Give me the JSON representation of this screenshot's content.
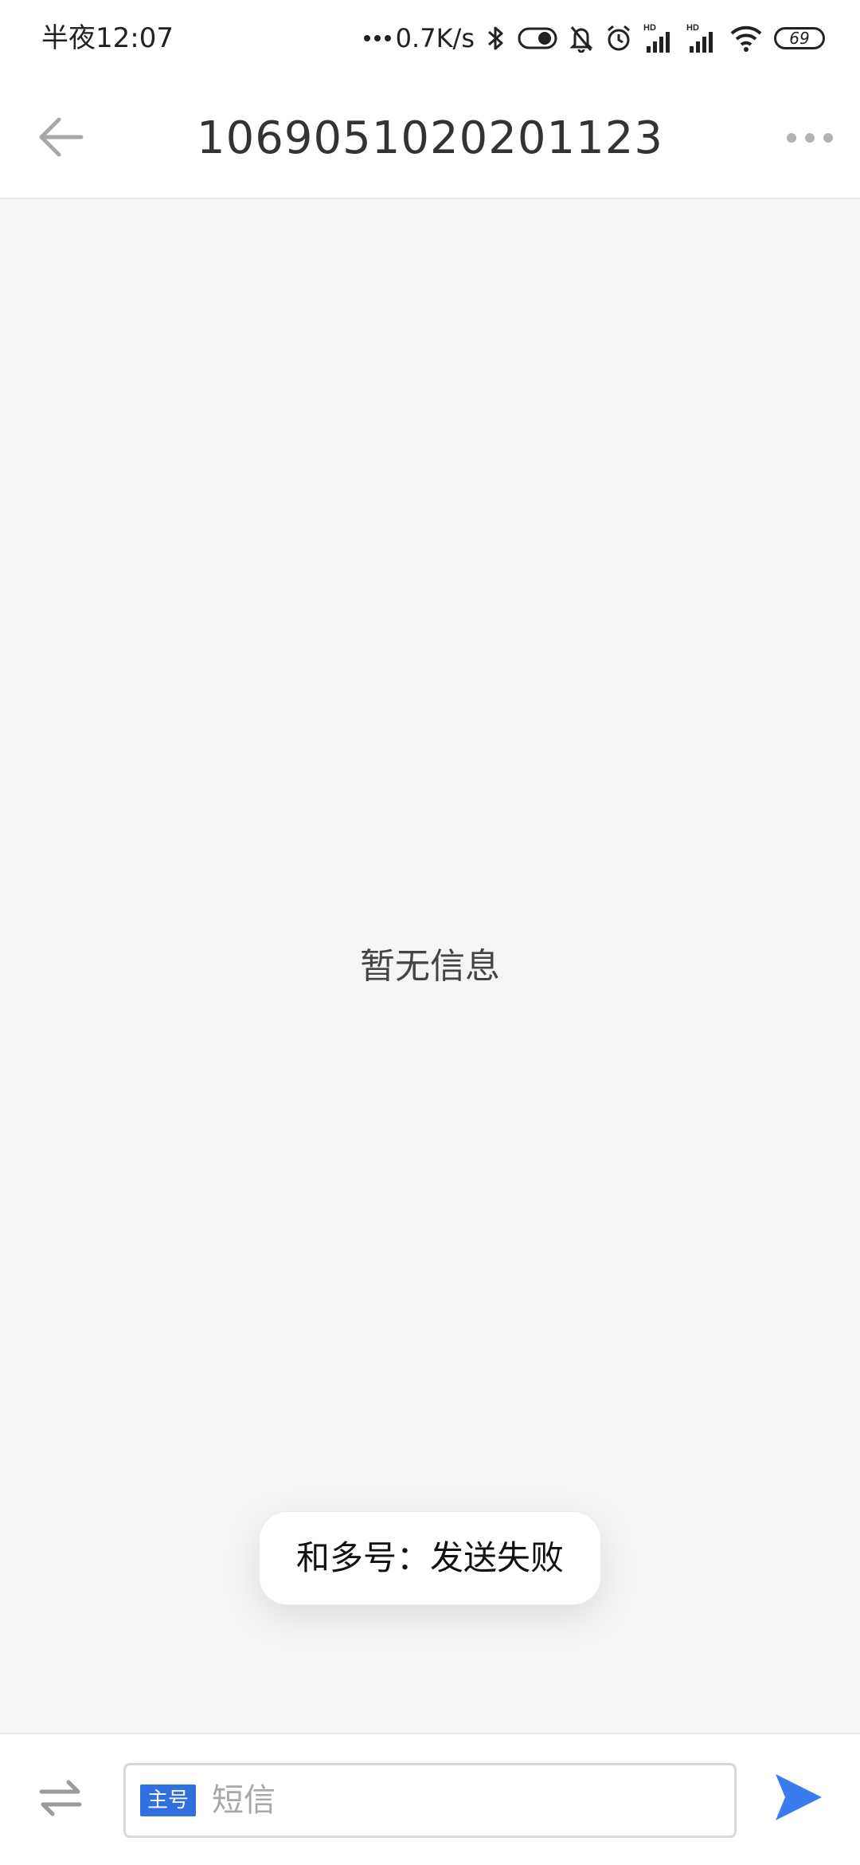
{
  "status_bar": {
    "time": "半夜12:07",
    "net_speed": "0.7K/s",
    "battery": "69",
    "icons": [
      "bluetooth-icon",
      "toggle-icon",
      "mute-bell-icon",
      "alarm-icon",
      "hd-signal-icon",
      "hd-signal-icon",
      "wifi-icon",
      "battery-icon"
    ]
  },
  "header": {
    "title": "1069051020201123",
    "back_icon": "back-arrow-icon",
    "more_icon": "more-dots-icon"
  },
  "content": {
    "empty_text": "暂无信息"
  },
  "toast": {
    "text": "和多号：发送失败"
  },
  "input_bar": {
    "switch_icon": "switch-arrows-icon",
    "sim_badge": "主号",
    "placeholder": "短信",
    "send_icon": "send-icon",
    "send_color": "#3a7cf0"
  }
}
